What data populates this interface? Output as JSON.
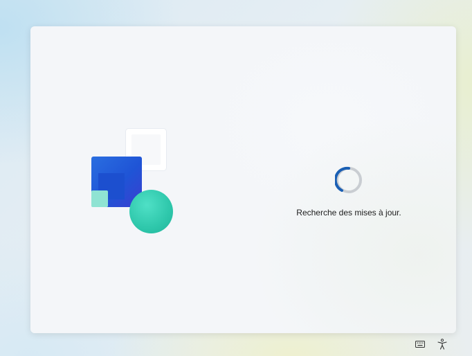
{
  "oobe": {
    "status_text": "Recherche des mises à jour.",
    "spinner_color": "#1a5fb4",
    "spinner_track_color": "#c9cdd2"
  },
  "tray": {
    "keyboard_icon": "keyboard-icon",
    "accessibility_icon": "accessibility-icon"
  },
  "colors": {
    "panel": "#f4f6f9",
    "illustration_blue": "#1f54d6",
    "illustration_teal": "#2ec7ab",
    "illustration_mint": "#8fe3d3"
  }
}
